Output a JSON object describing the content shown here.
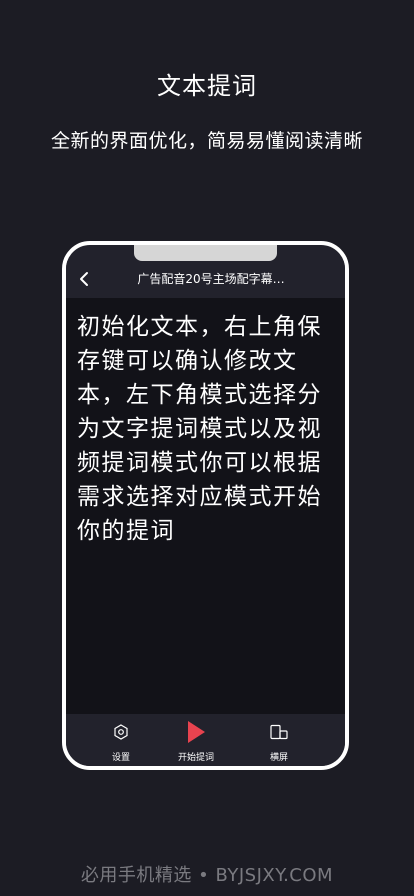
{
  "hero": {
    "title": "文本提词",
    "subtitle": "全新的界面优化，简易易懂阅读清晰"
  },
  "phone": {
    "header": {
      "back_icon": "chevron-left-icon",
      "title": "广告配音20号主场配字幕…"
    },
    "content_text": "初始化文本，右上角保存键可以确认修改文本，左下角模式选择分为文字提词模式以及视频提词模式你可以根据需求选择对应模式开始你的提词",
    "bottom_bar": {
      "settings_label": "设置",
      "start_label": "开始提词",
      "landscape_label": "横屏"
    }
  },
  "footer": {
    "text": "必用手机精选 • BYJSJXY.COM"
  },
  "colors": {
    "background": "#1c1c24",
    "accent_play": "#e8434f"
  }
}
